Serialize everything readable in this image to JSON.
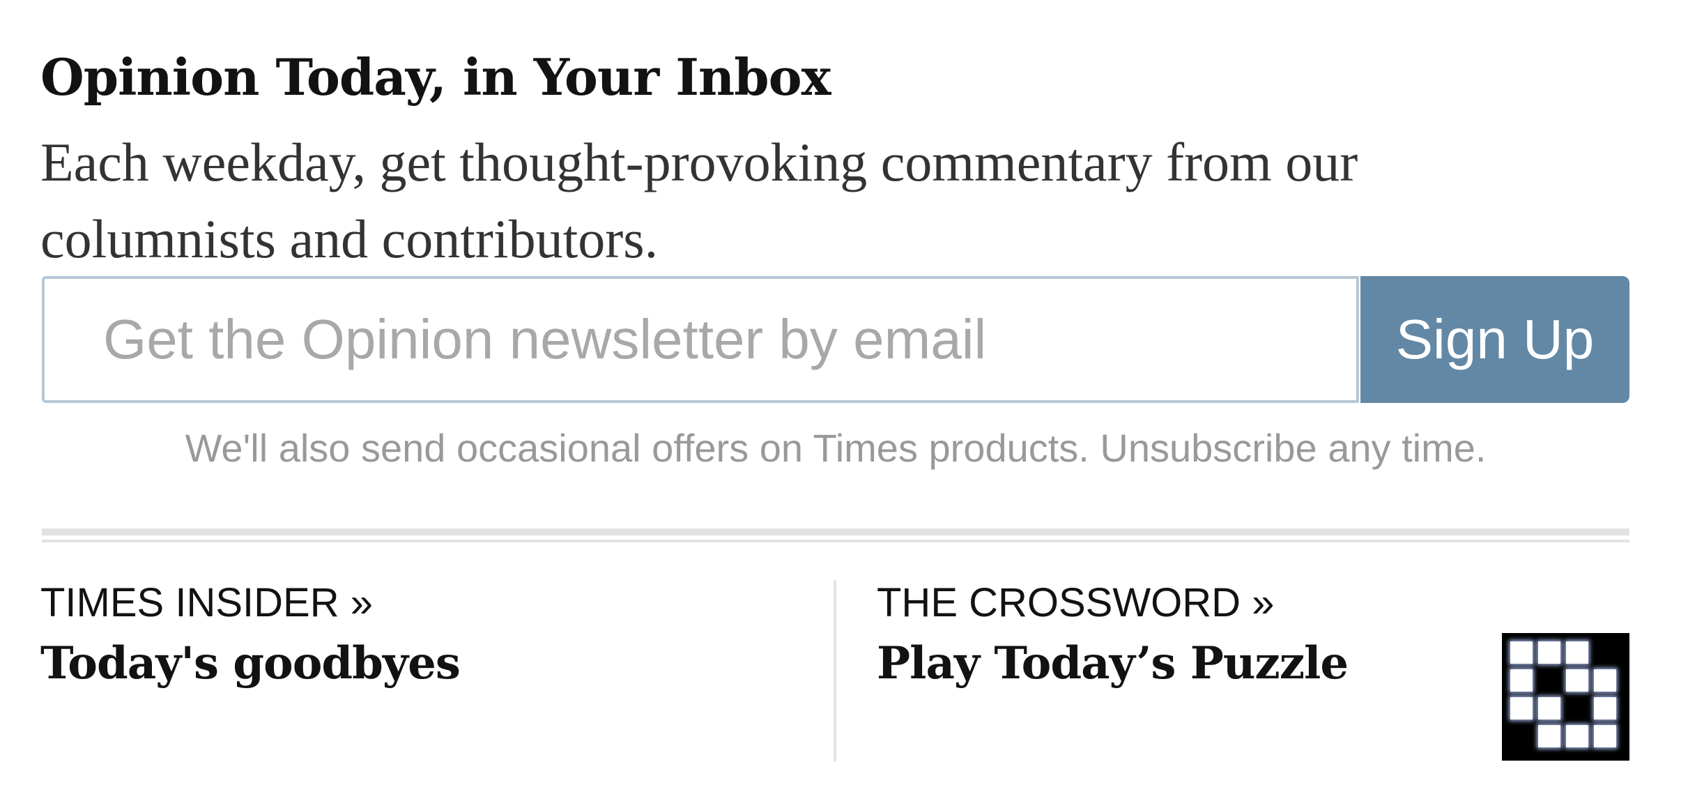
{
  "newsletter": {
    "title": "Opinion Today, in Your Inbox",
    "description": "Each weekday, get thought-provoking commentary from our columnists and contributors.",
    "email_placeholder": "Get the Opinion newsletter by email",
    "signup_label": "Sign Up",
    "note": "We'll also send occasional offers on Times products. Unsubscribe any time."
  },
  "promos": [
    {
      "kicker": "TIMES INSIDER »",
      "headline": "Today's goodbyes"
    },
    {
      "kicker": "THE CROSSWORD »",
      "headline": "Play Today’s Puzzle",
      "icon": "crossword-icon"
    }
  ],
  "colors": {
    "button": "#6288a5",
    "input_border": "#b7c7d4",
    "note_text": "#999999",
    "rule": "#e2e2e2"
  }
}
